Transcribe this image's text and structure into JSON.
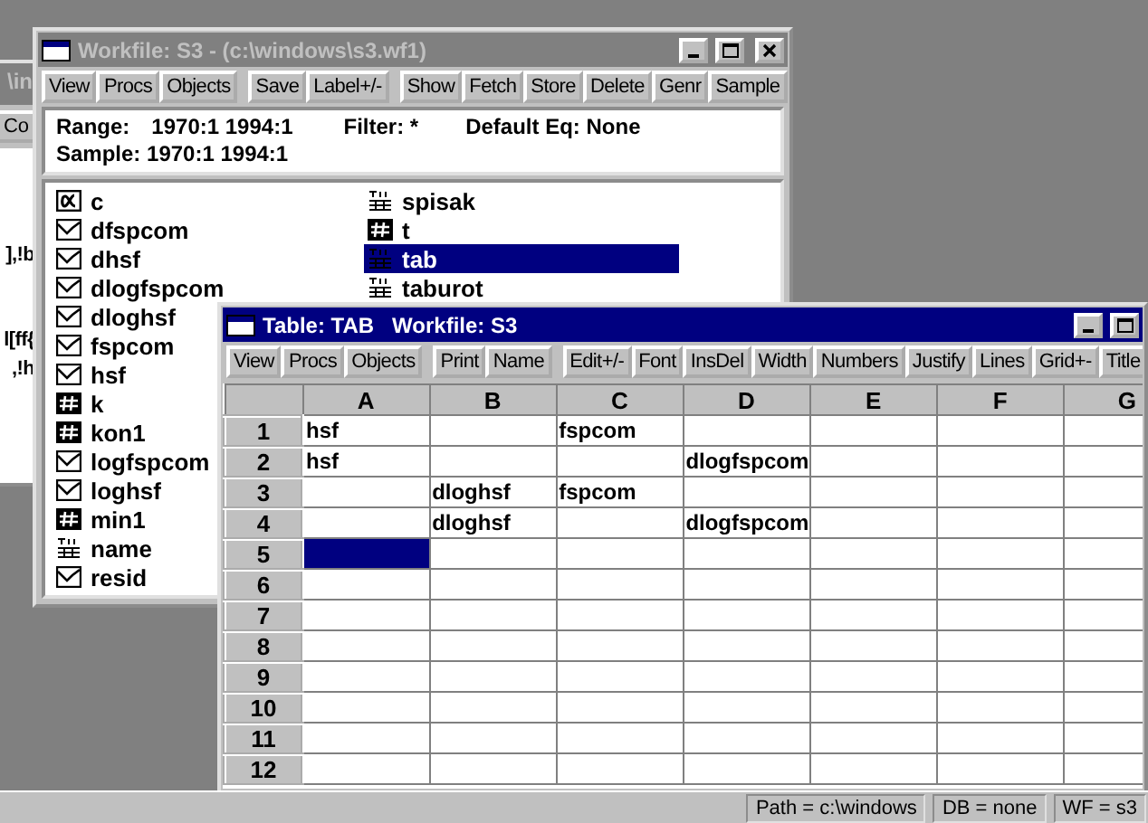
{
  "background_window": {
    "title": "\\in",
    "button": "Co",
    "text_lines": [
      "],!b",
      "l[ff{",
      ",!h"
    ]
  },
  "workfile_window": {
    "title": "Workfile: S3 - (c:\\windows\\s3.wf1)",
    "active": false,
    "toolbar": [
      [
        "View",
        "Procs",
        "Objects"
      ],
      [
        "Save",
        "Label+/-"
      ],
      [
        "Show",
        "Fetch",
        "Store",
        "Delete",
        "Genr",
        "Sample"
      ]
    ],
    "range_label": "Range:",
    "range": "1970:1 1994:1",
    "filter": "Filter: *",
    "default_eq": "Default Eq: None",
    "sample": "Sample: 1970:1 1994:1",
    "objects": [
      {
        "items": [
          {
            "name": "c",
            "kind": "alpha",
            "selected": false
          },
          {
            "name": "dfspcom",
            "kind": "series",
            "selected": false
          },
          {
            "name": "dhsf",
            "kind": "series",
            "selected": false
          },
          {
            "name": "dlogfspcom",
            "kind": "series",
            "selected": false
          },
          {
            "name": "dloghsf",
            "kind": "series",
            "selected": false
          },
          {
            "name": "fspcom",
            "kind": "series",
            "selected": false
          },
          {
            "name": "hsf",
            "kind": "series",
            "selected": false
          },
          {
            "name": "k",
            "kind": "scalar",
            "selected": false
          },
          {
            "name": "kon1",
            "kind": "scalar",
            "selected": false
          },
          {
            "name": "logfspcom",
            "kind": "series",
            "selected": false
          },
          {
            "name": "loghsf",
            "kind": "series",
            "selected": false
          },
          {
            "name": "min1",
            "kind": "scalar",
            "selected": false
          },
          {
            "name": "name",
            "kind": "table",
            "selected": false
          },
          {
            "name": "resid",
            "kind": "series",
            "selected": false
          }
        ]
      },
      {
        "items": [
          {
            "name": "spisak",
            "kind": "table",
            "selected": false
          },
          {
            "name": "t",
            "kind": "scalar",
            "selected": false
          },
          {
            "name": "tab",
            "kind": "table",
            "selected": true
          },
          {
            "name": "taburot",
            "kind": "table",
            "selected": false
          }
        ]
      }
    ]
  },
  "table_window": {
    "title": "Table: TAB   Workfile: S3",
    "active": true,
    "toolbar": [
      [
        "View",
        "Procs",
        "Objects"
      ],
      [
        "Print",
        "Name"
      ],
      [
        "Edit+/-",
        "Font",
        "InsDel",
        "Width",
        "Numbers",
        "Justify",
        "Lines",
        "Grid+-",
        "Title"
      ]
    ],
    "columns": [
      "A",
      "B",
      "C",
      "D",
      "E",
      "F",
      "G"
    ],
    "rows": [
      {
        "label": "1",
        "cells": [
          {
            "text": "hsf",
            "selected": false
          },
          {
            "selected": false
          },
          {
            "text": "fspcom",
            "selected": false
          },
          {
            "selected": false
          },
          {
            "selected": false
          },
          {
            "selected": false
          },
          {
            "selected": false
          }
        ]
      },
      {
        "label": "2",
        "cells": [
          {
            "text": "hsf",
            "selected": false
          },
          {
            "selected": false
          },
          {
            "selected": false
          },
          {
            "text": "dlogfspcom",
            "selected": false
          },
          {
            "selected": false
          },
          {
            "selected": false
          },
          {
            "selected": false
          }
        ]
      },
      {
        "label": "3",
        "cells": [
          {
            "selected": false
          },
          {
            "text": "dloghsf",
            "selected": false
          },
          {
            "text": "fspcom",
            "selected": false
          },
          {
            "selected": false
          },
          {
            "selected": false
          },
          {
            "selected": false
          },
          {
            "selected": false
          }
        ]
      },
      {
        "label": "4",
        "cells": [
          {
            "selected": false
          },
          {
            "text": "dloghsf",
            "selected": false
          },
          {
            "selected": false
          },
          {
            "text": "dlogfspcom",
            "selected": false
          },
          {
            "selected": false
          },
          {
            "selected": false
          },
          {
            "selected": false
          }
        ]
      },
      {
        "label": "5",
        "cells": [
          {
            "selected": true
          },
          {
            "selected": false
          },
          {
            "selected": false
          },
          {
            "selected": false
          },
          {
            "selected": false
          },
          {
            "selected": false
          },
          {
            "selected": false
          }
        ]
      },
      {
        "label": "6",
        "cells": [
          {
            "selected": false
          },
          {
            "selected": false
          },
          {
            "selected": false
          },
          {
            "selected": false
          },
          {
            "selected": false
          },
          {
            "selected": false
          },
          {
            "selected": false
          }
        ]
      },
      {
        "label": "7",
        "cells": [
          {
            "selected": false
          },
          {
            "selected": false
          },
          {
            "selected": false
          },
          {
            "selected": false
          },
          {
            "selected": false
          },
          {
            "selected": false
          },
          {
            "selected": false
          }
        ]
      },
      {
        "label": "8",
        "cells": [
          {
            "selected": false
          },
          {
            "selected": false
          },
          {
            "selected": false
          },
          {
            "selected": false
          },
          {
            "selected": false
          },
          {
            "selected": false
          },
          {
            "selected": false
          }
        ]
      },
      {
        "label": "9",
        "cells": [
          {
            "selected": false
          },
          {
            "selected": false
          },
          {
            "selected": false
          },
          {
            "selected": false
          },
          {
            "selected": false
          },
          {
            "selected": false
          },
          {
            "selected": false
          }
        ]
      },
      {
        "label": "10",
        "cells": [
          {
            "selected": false
          },
          {
            "selected": false
          },
          {
            "selected": false
          },
          {
            "selected": false
          },
          {
            "selected": false
          },
          {
            "selected": false
          },
          {
            "selected": false
          }
        ]
      },
      {
        "label": "11",
        "cells": [
          {
            "selected": false
          },
          {
            "selected": false
          },
          {
            "selected": false
          },
          {
            "selected": false
          },
          {
            "selected": false
          },
          {
            "selected": false
          },
          {
            "selected": false
          }
        ]
      },
      {
        "label": "12",
        "cells": [
          {
            "selected": false
          },
          {
            "selected": false
          },
          {
            "selected": false
          },
          {
            "selected": false
          },
          {
            "selected": false
          },
          {
            "selected": false
          },
          {
            "selected": false
          }
        ]
      }
    ]
  },
  "status_bar": {
    "fields": [
      "Path = c:\\windows",
      "DB = none",
      "WF = s3"
    ]
  }
}
